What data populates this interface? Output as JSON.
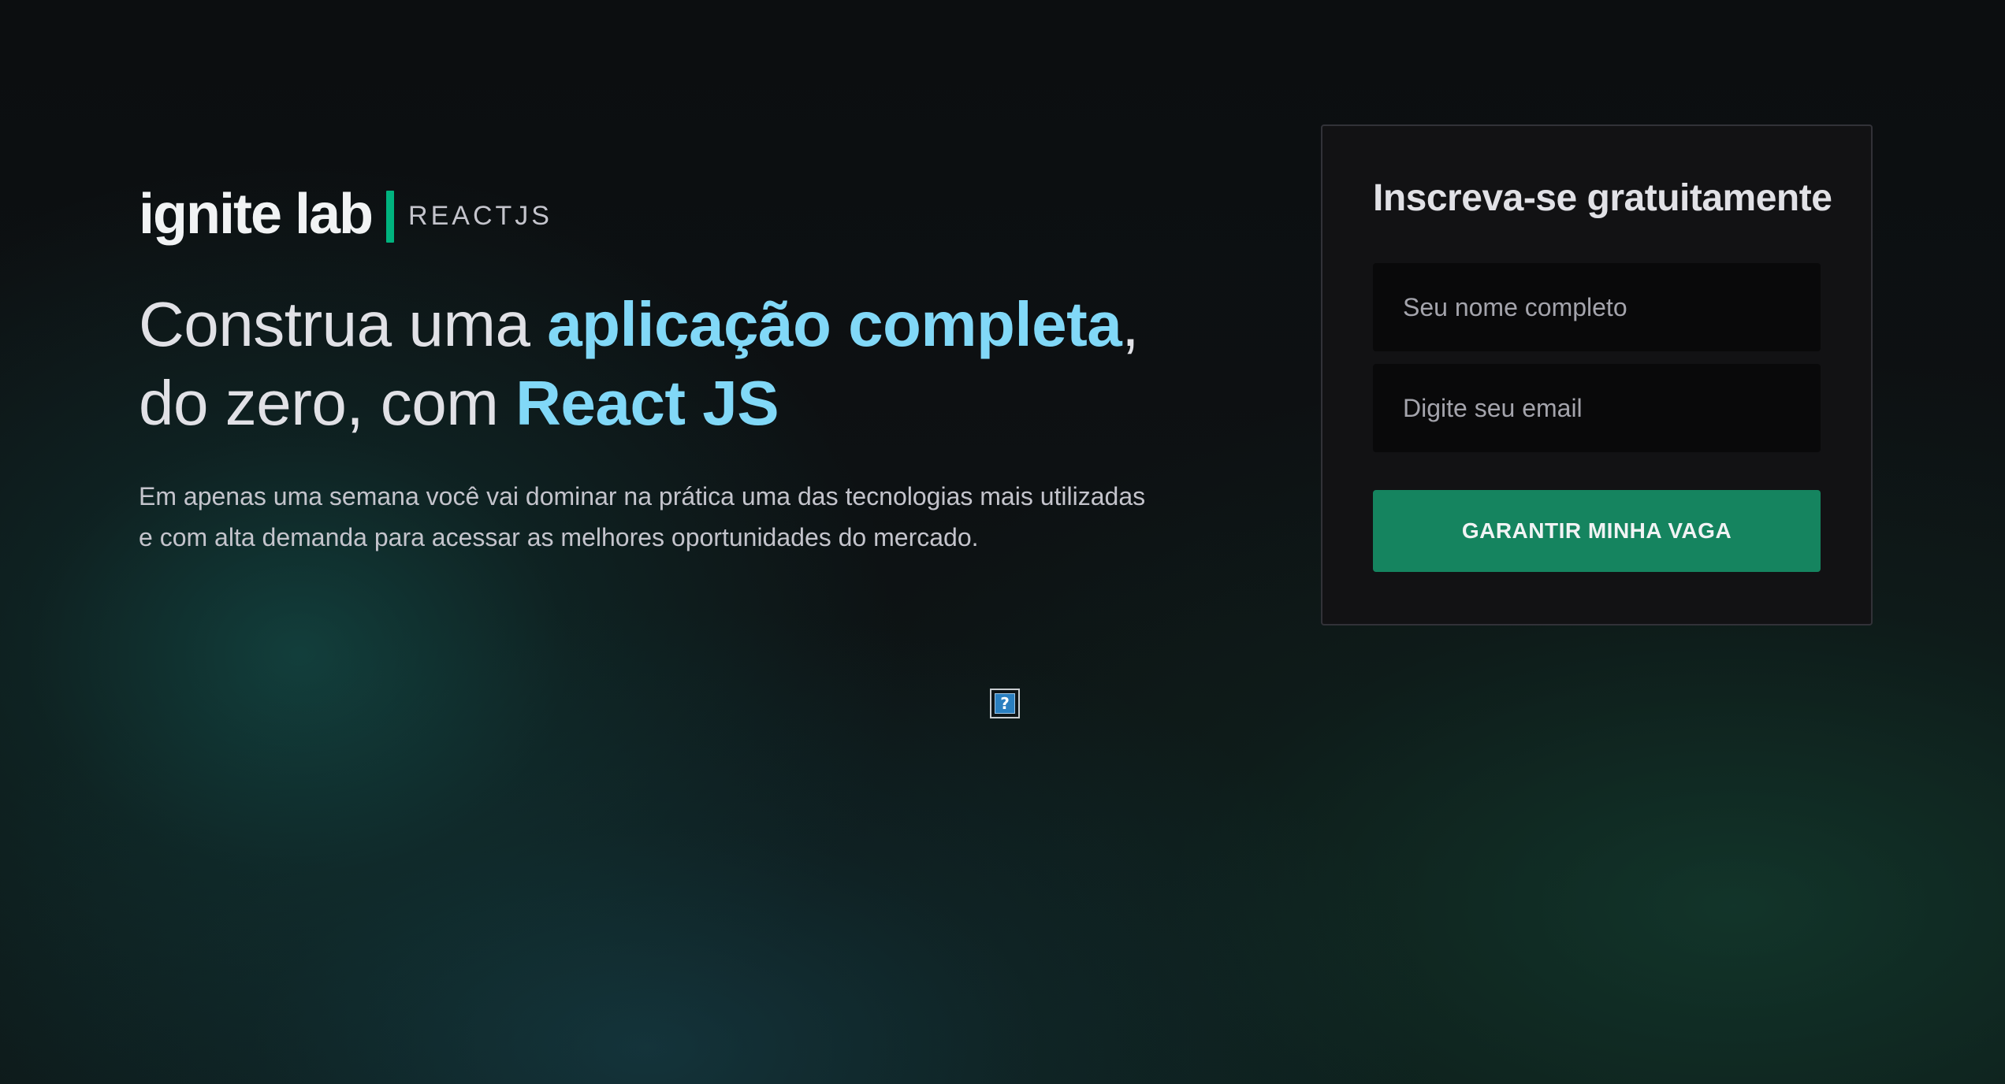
{
  "logo": {
    "wordmark": "ignite lab",
    "tag": "REACTJS",
    "accent_color": "#00b37e"
  },
  "hero": {
    "headline_part1": "Construa uma ",
    "headline_highlight1": "aplicação completa",
    "headline_part2": ", do zero, com ",
    "headline_highlight2": "React JS",
    "highlight_color": "#81d8f7",
    "subtitle": "Em apenas uma semana você vai dominar na prática uma das tecnologias mais utilizadas e com alta demanda para acessar as melhores oportunidades do mercado."
  },
  "broken_image": {
    "glyph": "?",
    "icon": "broken-image-icon"
  },
  "signup": {
    "title": "Inscreva-se gratuitamente",
    "name_placeholder": "Seu nome completo",
    "email_placeholder": "Digite seu email",
    "name_value": "",
    "email_value": "",
    "submit_label": "GARANTIR MINHA VAGA",
    "button_color": "#15845f"
  }
}
